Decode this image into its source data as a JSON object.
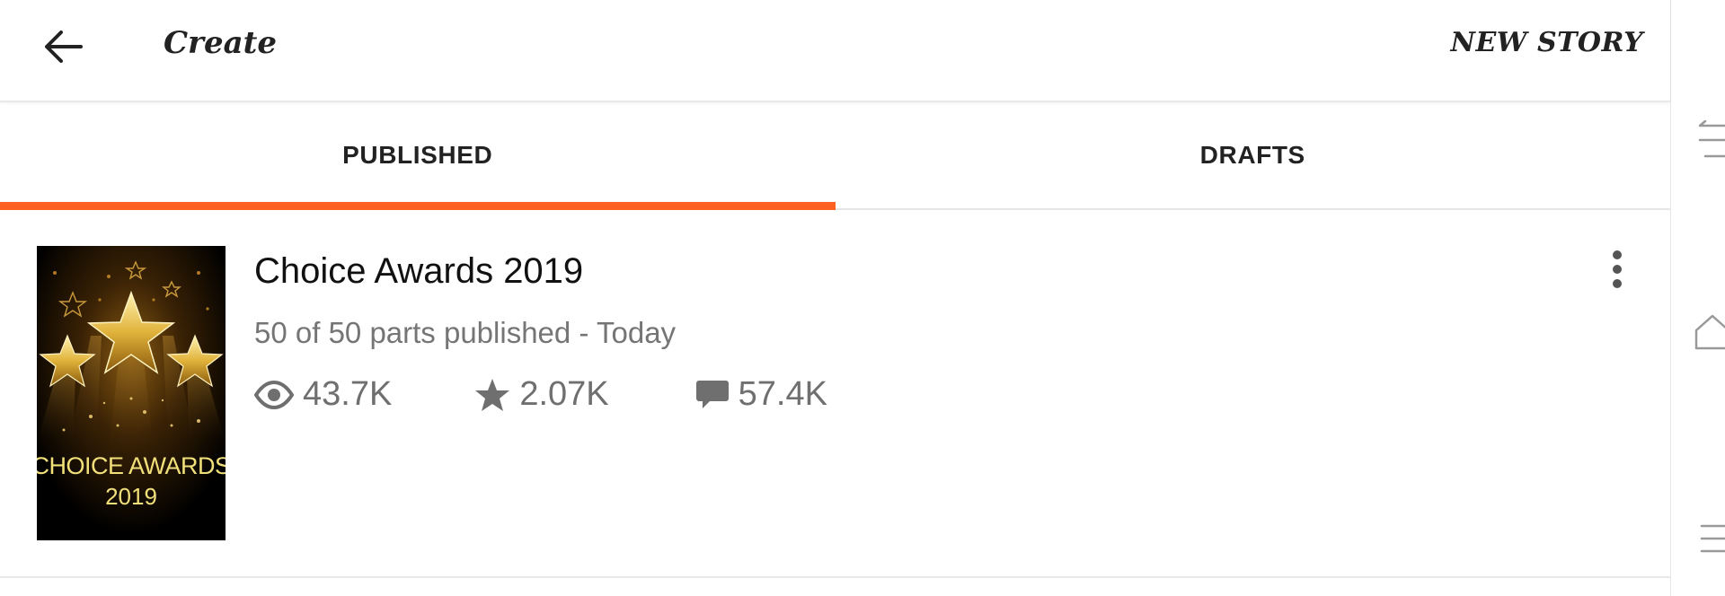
{
  "topbar": {
    "back_icon": "arrow-left-icon",
    "title": "Create",
    "new_story_label": "NEW STORY"
  },
  "tabs": [
    {
      "label": "PUBLISHED",
      "selected": true
    },
    {
      "label": "DRAFTS",
      "selected": false
    }
  ],
  "accent_color": "#ff6122",
  "story": {
    "cover_text_line1": "CHOICE AWARDS",
    "cover_text_line2": "2019",
    "title": "Choice Awards 2019",
    "meta": "50 of 50 parts published - Today",
    "stats": {
      "reads": "43.7K",
      "votes": "2.07K",
      "comments": "57.4K"
    },
    "reads_icon": "eye-icon",
    "votes_icon": "star-icon",
    "comments_icon": "comment-icon",
    "menu_icon": "more-vertical-icon"
  },
  "side_nav_icons": [
    "recent-apps-icon",
    "home-icon",
    "menu-icon"
  ]
}
